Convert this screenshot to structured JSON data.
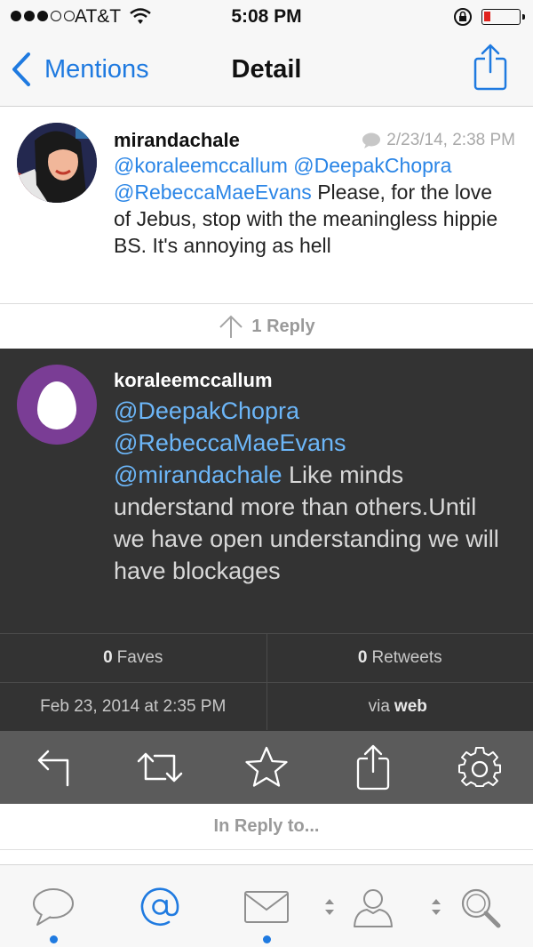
{
  "status_bar": {
    "carrier": "AT&T",
    "time": "5:08 PM",
    "signal_bars": 3,
    "signal_max": 5,
    "battery_level": 0.15,
    "battery_color": "#e0231d"
  },
  "nav": {
    "back_label": "Mentions",
    "title": "Detail",
    "share_icon": "share-icon"
  },
  "tweet": {
    "username": "mirandachale",
    "timestamp": "2/23/14, 2:38 PM",
    "mentions": [
      "@koraleemccallum",
      "@DeepakChopra",
      "@RebeccaMaeEvans"
    ],
    "body": "Please, for the love of Jebus, stop with the meaningless hippie BS. It's annoying as hell"
  },
  "reply_count": {
    "count": "1",
    "label": "Reply"
  },
  "reply": {
    "username": "koraleemccallum",
    "mentions": [
      "@DeepakChopra",
      "@RebeccaMaeEvans",
      "@mirandachale"
    ],
    "body": "Like minds understand more than others.Until we have open understanding we will have blockages",
    "faves_count": "0",
    "faves_label": "Faves",
    "retweets_count": "0",
    "retweets_label": "Retweets",
    "date": "Feb 23, 2014 at 2:35 PM",
    "via_prefix": "via",
    "via_source": "web"
  },
  "actions": [
    "reply-icon",
    "retweet-icon",
    "favorite-icon",
    "share-icon",
    "settings-icon"
  ],
  "in_reply_label": "In Reply to...",
  "tabs": [
    {
      "icon": "chat-bubble-icon",
      "active": false,
      "has_dot": true
    },
    {
      "icon": "at-sign-icon",
      "active": true,
      "has_dot": false
    },
    {
      "icon": "envelope-icon",
      "active": false,
      "has_dot": true
    },
    {
      "icon": "profile-icon",
      "active": false,
      "has_dot": false
    },
    {
      "icon": "search-icon",
      "active": false,
      "has_dot": false
    }
  ],
  "colors": {
    "accent": "#1f7ae0",
    "mention_light": "#2a85e6",
    "mention_dark": "#6cb6f8",
    "dark_panel": "#333333",
    "action_bar": "#5b5b5b"
  }
}
